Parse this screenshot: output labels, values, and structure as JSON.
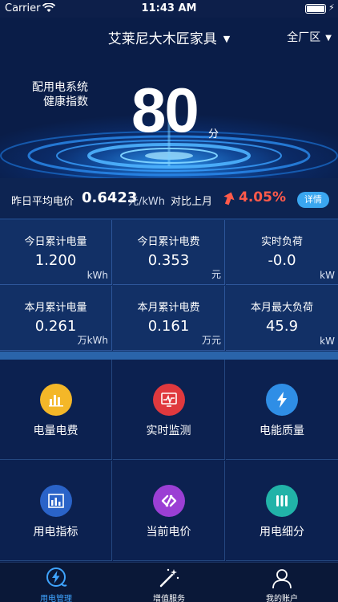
{
  "status_bar": {
    "carrier": "Carrier",
    "time": "11:43 AM"
  },
  "header": {
    "company": "艾莱尼大木匠家具",
    "area": "全厂区",
    "system_label_line1": "配用电系统",
    "system_label_line2": "健康指数",
    "score": "80",
    "score_unit": "分"
  },
  "price": {
    "label": "昨日平均电价",
    "value": "0.6423",
    "unit": "元/kWh",
    "compare_label": "对比上月",
    "change": "4.05%",
    "detail_button": "详情",
    "change_color": "#ff5a4a"
  },
  "stats": [
    {
      "label": "今日累计电量",
      "value": "1.200",
      "unit": "kWh"
    },
    {
      "label": "今日累计电费",
      "value": "0.353",
      "unit": "元"
    },
    {
      "label": "实时负荷",
      "value": "-0.0",
      "unit": "kW"
    },
    {
      "label": "本月累计电量",
      "value": "0.261",
      "unit": "万kWh"
    },
    {
      "label": "本月累计电费",
      "value": "0.161",
      "unit": "万元"
    },
    {
      "label": "本月最大负荷",
      "value": "45.9",
      "unit": "kW"
    }
  ],
  "menu": [
    {
      "label": "电量电费",
      "icon": "bar-chart-icon",
      "color": "#f4b728"
    },
    {
      "label": "实时监测",
      "icon": "monitor-icon",
      "color": "#e0393e"
    },
    {
      "label": "电能质量",
      "icon": "lightning-icon",
      "color": "#2f8ee6"
    },
    {
      "label": "用电指标",
      "icon": "indicator-chart-icon",
      "color": "#2a63c8"
    },
    {
      "label": "当前电价",
      "icon": "price-tag-icon",
      "color": "#9b3fd4"
    },
    {
      "label": "用电细分",
      "icon": "segments-icon",
      "color": "#21b3a8"
    }
  ],
  "tabs": [
    {
      "label": "用电管理",
      "icon": "power-plug-icon",
      "active": true,
      "color": "#3fa4ff"
    },
    {
      "label": "增值服务",
      "icon": "magic-wand-icon",
      "active": false,
      "color": "#ffffff"
    },
    {
      "label": "我的账户",
      "icon": "user-icon",
      "active": false,
      "color": "#ffffff"
    }
  ]
}
